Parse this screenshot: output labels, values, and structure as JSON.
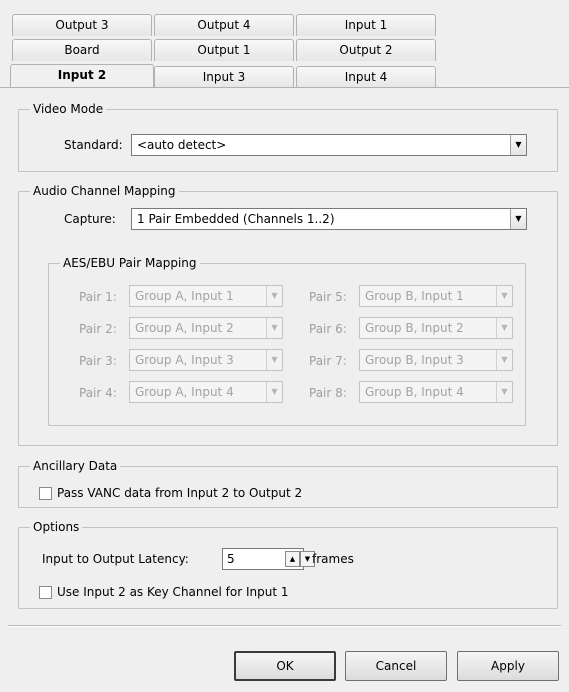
{
  "tabs": {
    "row1": [
      "Output 3",
      "Output 4",
      "Input 1"
    ],
    "row2": [
      "Board",
      "Output 1",
      "Output 2"
    ],
    "row3": [
      "Input 2",
      "Input 3",
      "Input 4"
    ],
    "active": "Input 2"
  },
  "video_mode": {
    "title": "Video Mode",
    "standard_label": "Standard:",
    "standard_value": "<auto detect>"
  },
  "audio": {
    "title": "Audio Channel Mapping",
    "capture_label": "Capture:",
    "capture_value": "1 Pair Embedded (Channels 1..2)",
    "aes_title": "AES/EBU Pair Mapping",
    "pairs": [
      {
        "label": "Pair 1:",
        "value": "Group A, Input 1"
      },
      {
        "label": "Pair 2:",
        "value": "Group A, Input 2"
      },
      {
        "label": "Pair 3:",
        "value": "Group A, Input 3"
      },
      {
        "label": "Pair 4:",
        "value": "Group A, Input 4"
      },
      {
        "label": "Pair 5:",
        "value": "Group B, Input 1"
      },
      {
        "label": "Pair 6:",
        "value": "Group B, Input 2"
      },
      {
        "label": "Pair 7:",
        "value": "Group B, Input 3"
      },
      {
        "label": "Pair 8:",
        "value": "Group B, Input 4"
      }
    ]
  },
  "ancillary": {
    "title": "Ancillary Data",
    "vanc_label": "Pass VANC data from Input 2 to Output 2",
    "vanc_checked": false
  },
  "options": {
    "title": "Options",
    "latency_label": "Input to Output Latency:",
    "latency_value": "5",
    "latency_unit": "frames",
    "key_label": "Use Input 2 as Key Channel for Input 1",
    "key_checked": false
  },
  "buttons": {
    "ok": "OK",
    "cancel": "Cancel",
    "apply": "Apply"
  }
}
